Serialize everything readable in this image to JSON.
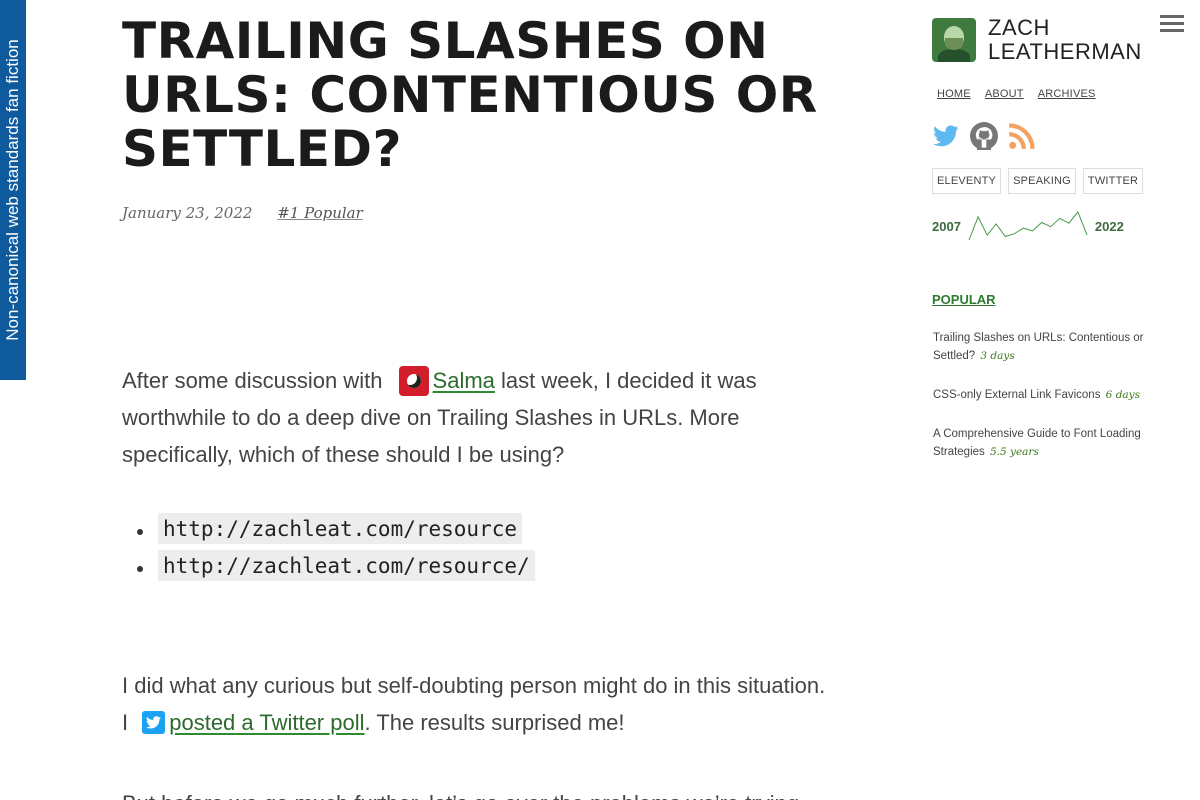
{
  "ribbon": {
    "label": "Non-canonical web standards fan fiction"
  },
  "article": {
    "title": "Trailing Slashes on URLs: Contentious or Settled?",
    "date": "January 23, 2022",
    "popular_badge": "#1 Popular",
    "p1": {
      "before": "After some discussion with ",
      "link": "Salma",
      "after": " last week, I decided it was worthwhile to do a deep dive on Trailing Slashes in URLs. More specifically, which of these should I be using?"
    },
    "urls": [
      "http://zachleat.com/resource",
      "http://zachleat.com/resource/"
    ],
    "p2": {
      "before": "I did what any curious but self-doubting person might do in this situation. I ",
      "link": "posted a Twitter poll",
      "after": ". The results surprised me!"
    },
    "p3": "But before we go much further, let’s go over the problems we’re trying"
  },
  "sidebar": {
    "name_line1": "ZACH",
    "name_line2": "LEATHERMAN",
    "nav": [
      "HOME",
      "ABOUT",
      "ARCHIVES"
    ],
    "social_icons": [
      "twitter-icon",
      "github-icon",
      "rss-icon"
    ],
    "tags": [
      "ELEVENTY",
      "SPEAKING",
      "TWITTER"
    ],
    "sparkline": {
      "start_label": "2007",
      "end_label": "2022",
      "values": [
        5,
        38,
        12,
        28,
        10,
        14,
        22,
        18,
        30,
        24,
        36,
        29,
        45,
        12
      ],
      "color": "#4c9a4c"
    },
    "popular_heading": "POPULAR",
    "popular_items": [
      {
        "title": "Trailing Slashes on URLs: Contentious or Settled?",
        "age": "3 days"
      },
      {
        "title": "CSS-only External Link Favicons",
        "age": "6 days"
      },
      {
        "title": "A Comprehensive Guide to Font Loading Strategies",
        "age": "5.5 years"
      }
    ]
  },
  "colors": {
    "ribbon": "#0e5a9c",
    "accent_green": "#2f7a2f",
    "twitter_blue": "#1da1f2",
    "rss_orange": "#f4a261"
  }
}
